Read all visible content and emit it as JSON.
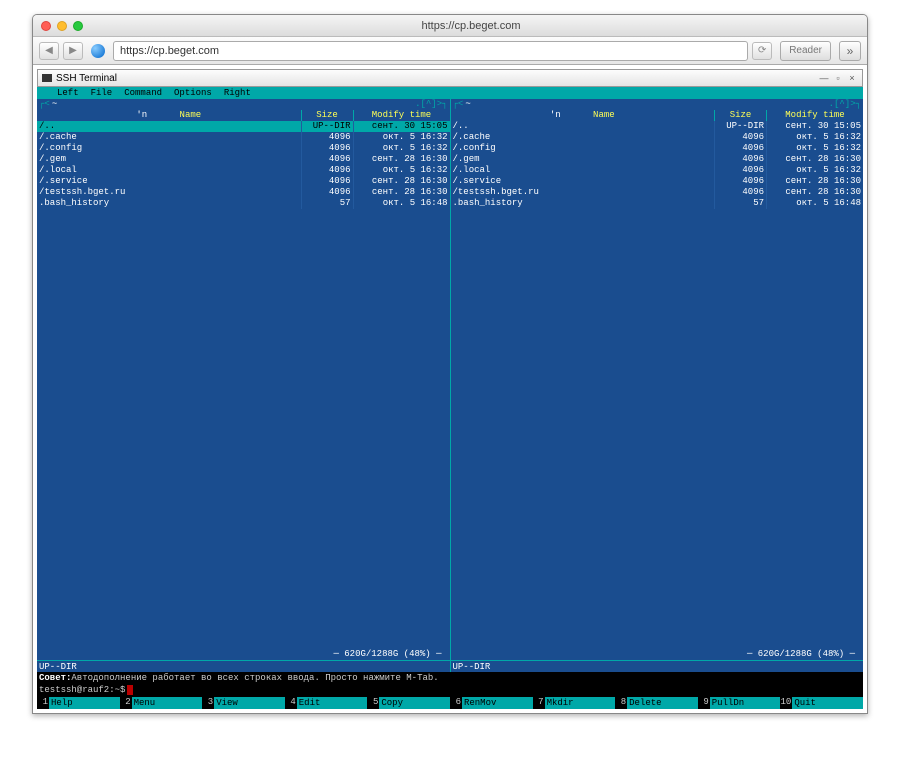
{
  "browser": {
    "title": "https://cp.beget.com",
    "url": "https://cp.beget.com",
    "reader": "Reader"
  },
  "inner_window": {
    "title": "SSH Terminal"
  },
  "menubar": [
    "Left",
    "File",
    "Command",
    "Options",
    "Right"
  ],
  "panel": {
    "sort_indicator": ".[^]",
    "sort_left": "'n",
    "headers": {
      "name": "Name",
      "size": "Size",
      "time": "Modify time"
    },
    "rows": [
      {
        "name": "/..",
        "size": "UP--DIR",
        "time": "сент. 30 15:05",
        "selected": true
      },
      {
        "name": "/.cache",
        "size": "4096",
        "time": "окт.  5 16:32"
      },
      {
        "name": "/.config",
        "size": "4096",
        "time": "окт.  5 16:32"
      },
      {
        "name": "/.gem",
        "size": "4096",
        "time": "сент. 28 16:30"
      },
      {
        "name": "/.local",
        "size": "4096",
        "time": "окт.  5 16:32"
      },
      {
        "name": "/.service",
        "size": "4096",
        "time": "сент. 28 16:30"
      },
      {
        "name": "/testssh.bget.ru",
        "size": "4096",
        "time": "сент. 28 16:30"
      },
      {
        "name": " .bash_history",
        "size": "57",
        "time": "окт.  5 16:48"
      }
    ],
    "status": "UP--DIR",
    "disk": "620G/1288G (48%)"
  },
  "hint": {
    "label": "Совет:",
    "text": " Автодополнение работает во всех строках ввода. Просто нажмите M-Tab."
  },
  "prompt": "testssh@rauf2:~$ ",
  "fkeys": [
    {
      "n": "1",
      "label": "Help"
    },
    {
      "n": "2",
      "label": "Menu"
    },
    {
      "n": "3",
      "label": "View"
    },
    {
      "n": "4",
      "label": "Edit"
    },
    {
      "n": "5",
      "label": "Copy"
    },
    {
      "n": "6",
      "label": "RenMov"
    },
    {
      "n": "7",
      "label": "Mkdir"
    },
    {
      "n": "8",
      "label": "Delete"
    },
    {
      "n": "9",
      "label": "PullDn"
    },
    {
      "n": "10",
      "label": "Quit"
    }
  ]
}
